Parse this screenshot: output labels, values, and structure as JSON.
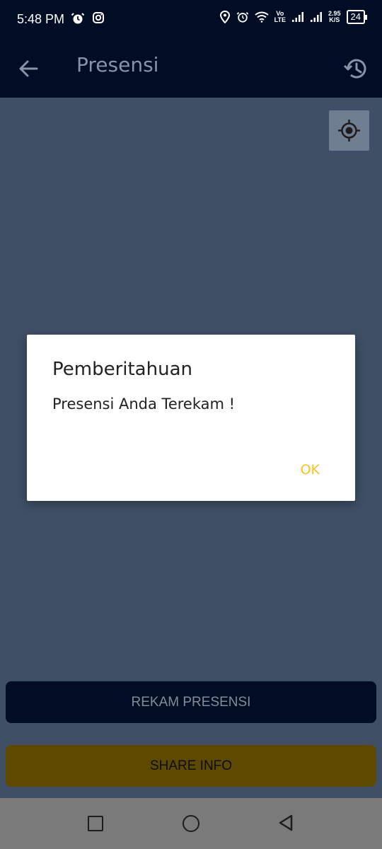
{
  "status_bar": {
    "time": "5:48 PM",
    "network_speed": "2.95",
    "network_speed_unit": "K/S",
    "battery": "24",
    "volte_top": "Vo",
    "volte_bottom": "LTE"
  },
  "app_bar": {
    "title": "Presensi",
    "back_icon": "arrow-left-icon",
    "history_icon": "history-icon"
  },
  "map": {
    "locate_icon": "my-location-icon"
  },
  "dialog": {
    "title": "Pemberitahuan",
    "message": "Presensi Anda Terekam !",
    "ok_label": "OK"
  },
  "actions": {
    "rekam_label": "REKAM PRESENSI",
    "share_label": "SHARE INFO"
  },
  "colors": {
    "app_bar": "#000d24",
    "scrim": "#3f4f66",
    "accent": "#f5c518",
    "share_button": "#5d4a00"
  }
}
